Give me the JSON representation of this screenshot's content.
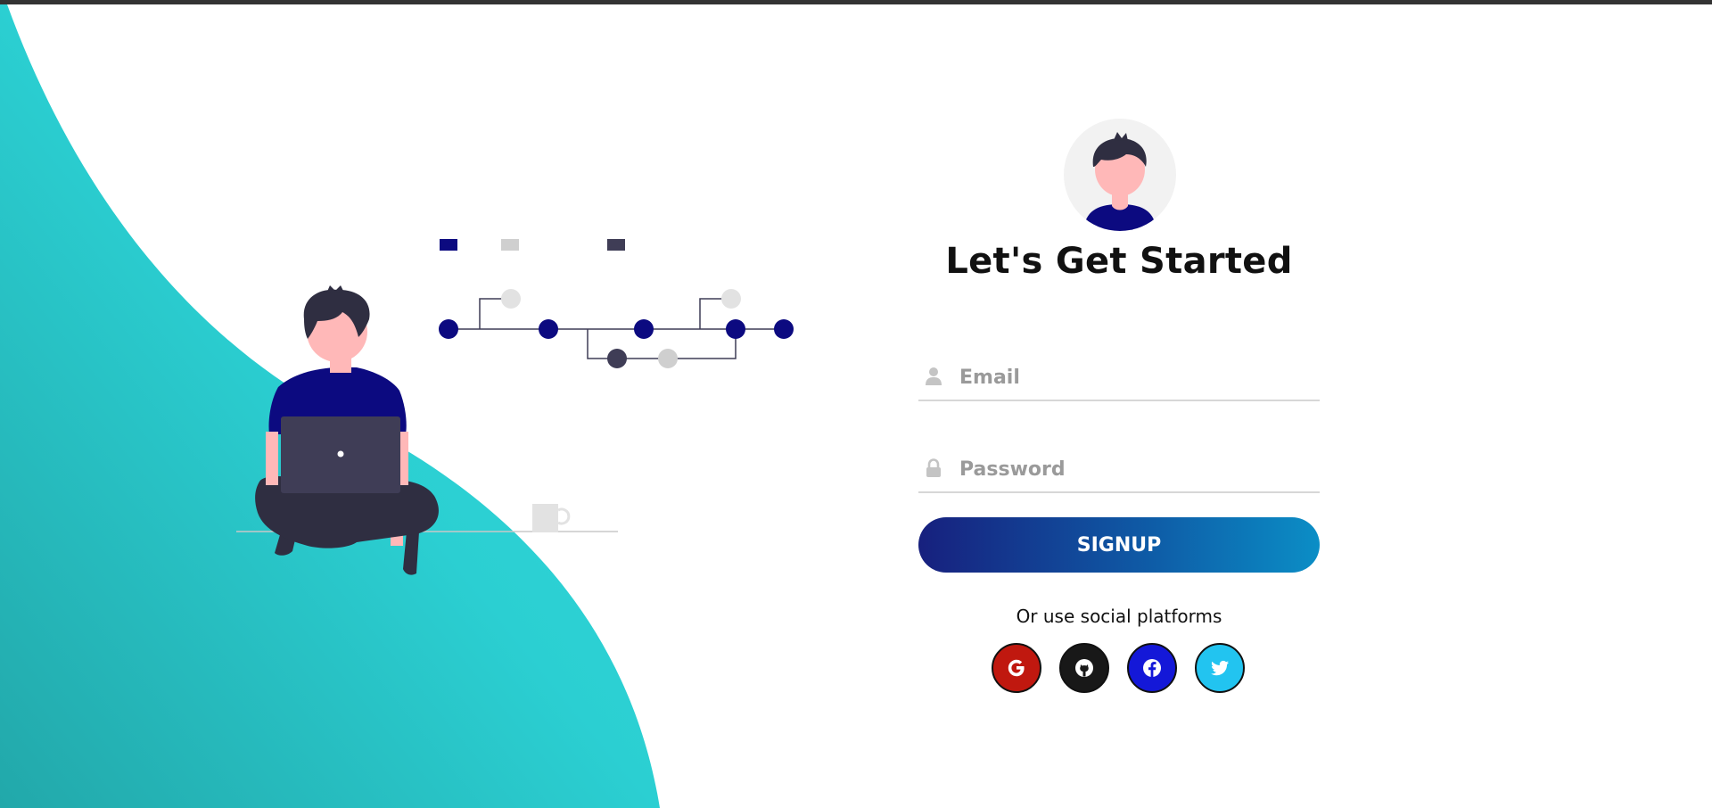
{
  "colors": {
    "wave": "#2bcfd2",
    "accent_navy": "#0c0a80",
    "signup_gradient_start": "#17207e",
    "signup_gradient_end": "#0b8ec6",
    "google": "#c0180f",
    "github": "#181818",
    "facebook": "#1418d8",
    "twitter": "#22c4f0"
  },
  "illustration": {
    "subject": "person-with-laptop-illustration",
    "decor_icons": [
      "person-icon",
      "laptop-icon",
      "timeline-icon",
      "mug-icon"
    ]
  },
  "form": {
    "avatar_icon": "user-avatar-icon",
    "title": "Let's Get Started",
    "email": {
      "placeholder": "Email",
      "value": "",
      "icon": "user-icon"
    },
    "password": {
      "placeholder": "Password",
      "value": "",
      "icon": "lock-icon"
    },
    "submit_label": "SIGNUP",
    "social_text": "Or use social platforms",
    "social": [
      {
        "name": "google",
        "icon": "google-icon"
      },
      {
        "name": "github",
        "icon": "github-icon"
      },
      {
        "name": "facebook",
        "icon": "facebook-icon"
      },
      {
        "name": "twitter",
        "icon": "twitter-icon"
      }
    ]
  }
}
